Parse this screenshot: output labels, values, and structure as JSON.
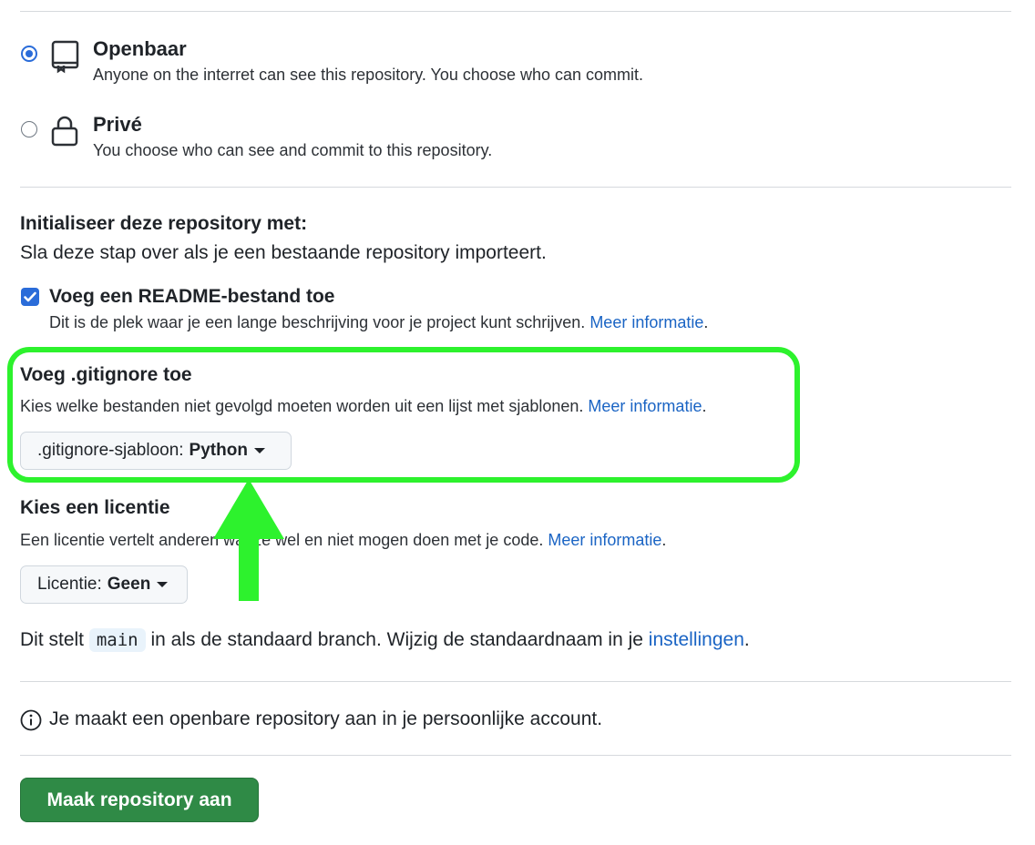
{
  "visibility": {
    "public": {
      "title": "Openbaar",
      "description": "Anyone on the interret can see this repository. You choose who can commit.",
      "selected": true,
      "icon": "repo-icon"
    },
    "private": {
      "title": "Privé",
      "description": "You choose who can see and commit to this repository.",
      "selected": false,
      "icon": "lock-icon"
    }
  },
  "initialize": {
    "title": "Initialiseer deze repository met:",
    "subtitle": "Sla deze stap over als je een bestaande repository importeert.",
    "readme": {
      "label": "Voeg een README-bestand toe",
      "checked": true,
      "description": "Dit is de plek waar je een lange beschrijving voor je project kunt schrijven.",
      "link": "Meer informatie",
      "suffix": "."
    },
    "gitignore": {
      "title": "Voeg .gitignore toe",
      "description": "Kies welke bestanden niet gevolgd moeten worden uit een lijst met sjablonen.",
      "link": "Meer informatie",
      "suffix": ".",
      "button_prefix": ".gitignore-sjabloon:",
      "button_value": "Python"
    },
    "license": {
      "title": "Kies een licentie",
      "description": "Een licentie vertelt anderen wat ze wel en niet mogen doen met je code.",
      "link": "Meer informatie",
      "suffix": ".",
      "button_prefix": "Licentie:",
      "button_value": "Geen"
    }
  },
  "branch_note": {
    "before": "Dit stelt",
    "code": "main",
    "after": "in als de standaard branch. Wijzig de standaardnaam in je",
    "link": "instellingen",
    "suffix": "."
  },
  "info_note": "Je maakt een openbare repository aan in je persoonlijke account.",
  "create_button": "Maak repository aan",
  "colors": {
    "accent": "#2a6cd9",
    "link": "#1a64c4",
    "highlight": "#2df22d",
    "create_button": "#2f8a46"
  }
}
